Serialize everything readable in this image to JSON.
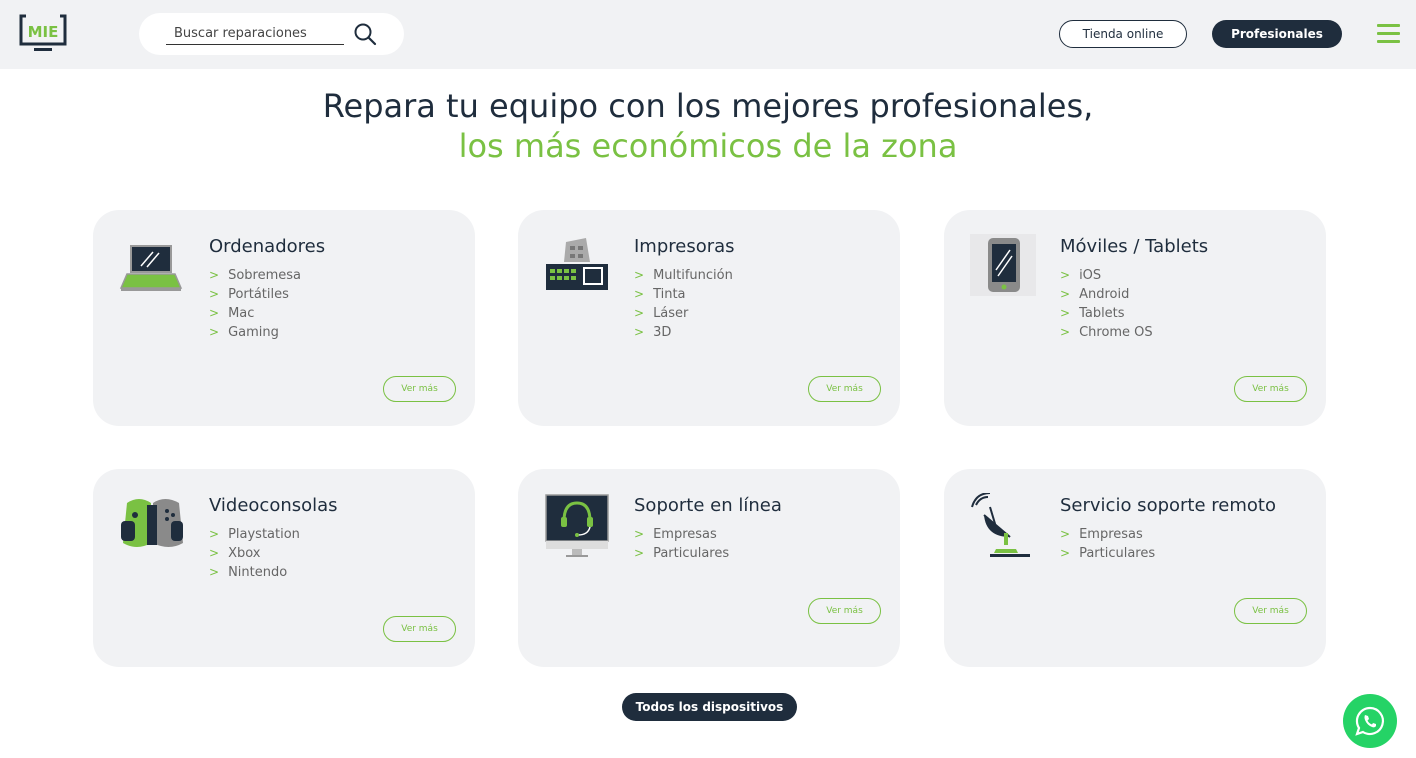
{
  "header": {
    "logo_text": "MIE",
    "search_placeholder": "Buscar reparaciones",
    "tienda_label": "Tienda online",
    "profesionales_label": "Profesionales"
  },
  "hero": {
    "line1": "Repara tu equipo con los mejores profesionales,",
    "line2": "los más económicos de la zona"
  },
  "cards": [
    {
      "title": "Ordenadores",
      "icon": "laptop-icon",
      "items": [
        "Sobremesa",
        "Portátiles",
        "Mac",
        "Gaming"
      ],
      "button": "Ver más"
    },
    {
      "title": "Impresoras",
      "icon": "printer-icon",
      "items": [
        "Multifunción",
        "Tinta",
        "Láser",
        "3D"
      ],
      "button": "Ver más"
    },
    {
      "title": "Móviles / Tablets",
      "icon": "smartphone-icon",
      "items": [
        "iOS",
        "Android",
        "Tablets",
        "Chrome OS"
      ],
      "button": "Ver más"
    },
    {
      "title": "Videoconsolas",
      "icon": "gamepad-icon",
      "items": [
        "Playstation",
        "Xbox",
        "Nintendo"
      ],
      "button": "Ver más"
    },
    {
      "title": "Soporte en línea",
      "icon": "headset-monitor-icon",
      "items": [
        "Empresas",
        "Particulares"
      ],
      "button": "Ver más"
    },
    {
      "title": "Servicio soporte remoto",
      "icon": "satellite-dish-icon",
      "items": [
        "Empresas",
        "Particulares"
      ],
      "button": "Ver más"
    }
  ],
  "all_devices_label": "Todos los dispositivos",
  "item_marker": ">",
  "colors": {
    "accent": "#7ac143",
    "dark": "#1f2d3d",
    "card_bg": "#f1f2f4",
    "whatsapp": "#25d366"
  }
}
